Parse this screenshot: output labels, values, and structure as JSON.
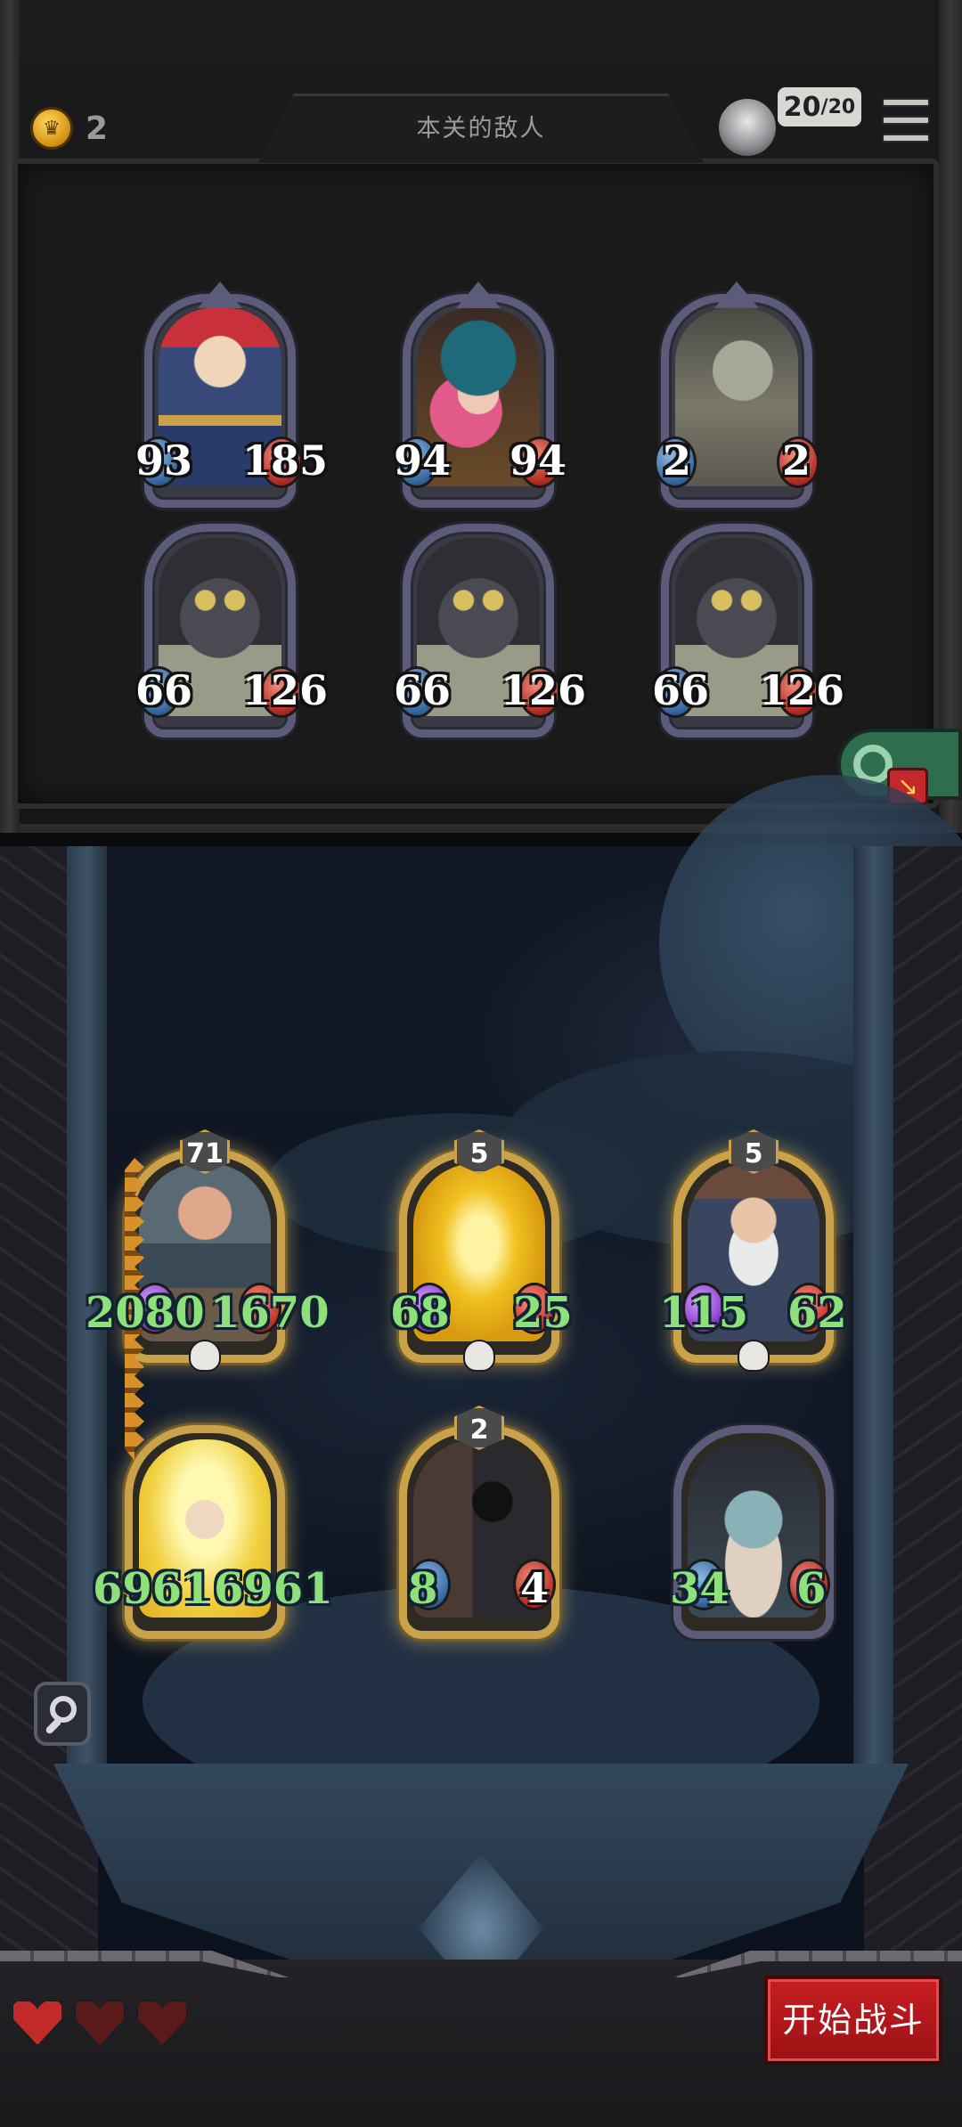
{
  "header": {
    "title": "本关的敌人",
    "gold": "2",
    "hp_current": "20",
    "hp_max": "/20"
  },
  "enemies": [
    {
      "name": "nutcracker-soldier",
      "atk": "93",
      "hp": "185"
    },
    {
      "name": "pink-hair-girl",
      "atk": "94",
      "hp": "94"
    },
    {
      "name": "old-doctor",
      "atk": "2",
      "hp": "2"
    },
    {
      "name": "wolf-1",
      "atk": "66",
      "hp": "126"
    },
    {
      "name": "wolf-2",
      "atk": "66",
      "hp": "126"
    },
    {
      "name": "wolf-3",
      "atk": "66",
      "hp": "126"
    }
  ],
  "heroes": [
    {
      "name": "pirate-brute",
      "level": "71",
      "atk": "2080",
      "hp": "1670",
      "style": "gold"
    },
    {
      "name": "golden-dragon",
      "level": "5",
      "atk": "68",
      "hp": "25",
      "style": "gold"
    },
    {
      "name": "bearded-elder",
      "level": "5",
      "atk": "115",
      "hp": "62",
      "style": "gold"
    },
    {
      "name": "lightning-gnome",
      "level": "",
      "atk": "6961",
      "hp": "6961",
      "style": "gold"
    },
    {
      "name": "shield-knight",
      "level": "2",
      "atk": "8",
      "hp": "4",
      "style": "gold"
    },
    {
      "name": "horned-beast",
      "level": "",
      "atk": "34",
      "hp": "6",
      "style": "plain"
    }
  ],
  "footer": {
    "start_label": "开始战斗",
    "lives": [
      "full",
      "empty",
      "empty"
    ]
  },
  "colors": {
    "accent_red": "#c81e22",
    "stat_green": "#8ee07a",
    "gold_frame": "#c9a24a"
  }
}
